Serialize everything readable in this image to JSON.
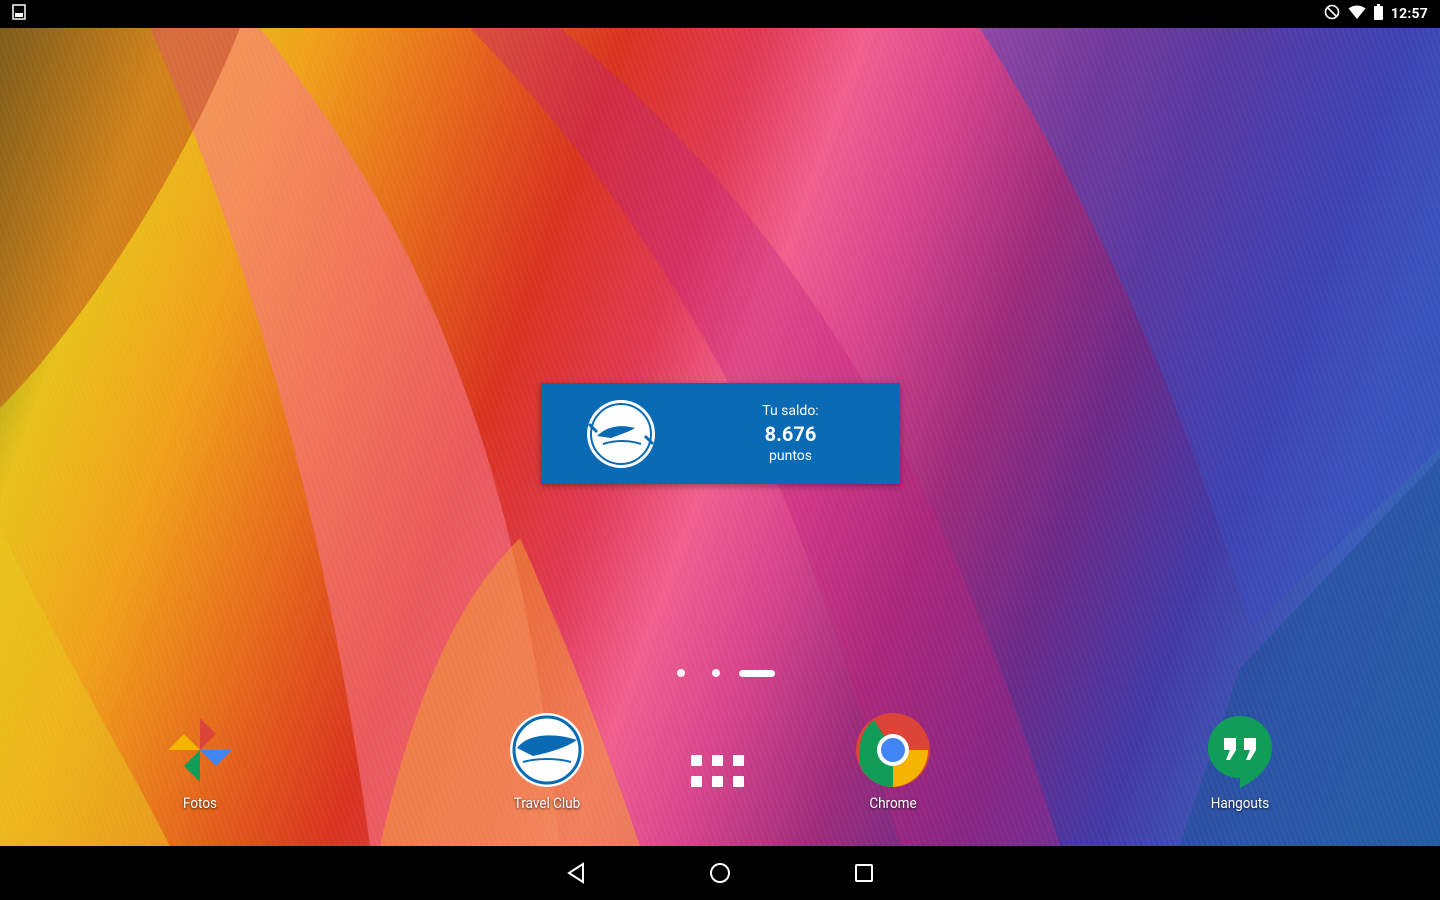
{
  "status_bar": {
    "time": "12:57",
    "icons": [
      "screenshot-notification-icon",
      "do-not-disturb-icon",
      "wifi-icon",
      "battery-icon"
    ]
  },
  "widget": {
    "balance_label": "Tu saldo:",
    "balance_value": "8.676",
    "balance_unit": "puntos",
    "background": "#0a6ab3"
  },
  "pager": {
    "pages": 3,
    "current_page": 3
  },
  "dock": {
    "apps": [
      {
        "label": "Fotos",
        "icon": "google-photos-pinwheel-icon"
      },
      {
        "label": "Travel Club",
        "icon": "travel-club-logo-icon"
      },
      {
        "label": "Chrome",
        "icon": "chrome-icon"
      },
      {
        "label": "Hangouts",
        "icon": "hangouts-icon"
      }
    ],
    "app_drawer_icon": "app-drawer-grid-icon"
  },
  "nav_bar": {
    "buttons": [
      "back-icon",
      "home-icon",
      "recents-icon"
    ]
  }
}
